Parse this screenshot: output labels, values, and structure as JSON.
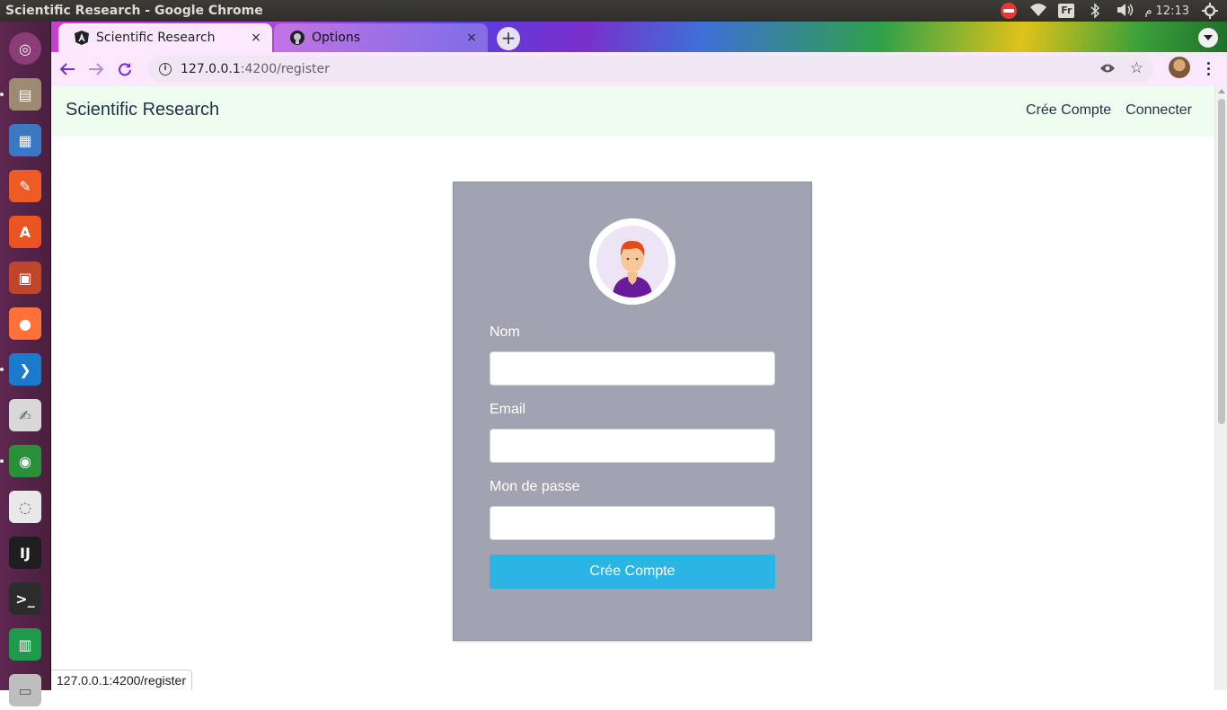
{
  "os": {
    "window_title": "Scientific Research - Google Chrome",
    "keyboard_layout": "Fr",
    "clock_ampm": "م",
    "clock_time": "12:13"
  },
  "launcher": {
    "apps": [
      {
        "name": "ubuntu-dash",
        "glyph": "◎",
        "color": "#8c3c77"
      },
      {
        "name": "files",
        "glyph": "▤",
        "color": "#9c8a72"
      },
      {
        "name": "libreoffice-impress-doc",
        "glyph": "▦",
        "color": "#3a78c3"
      },
      {
        "name": "postman",
        "glyph": "✎",
        "color": "#ef5b25"
      },
      {
        "name": "ubuntu-software",
        "glyph": "A",
        "color": "#e95420"
      },
      {
        "name": "libreoffice-impress",
        "glyph": "▣",
        "color": "#c0462a"
      },
      {
        "name": "firefox",
        "glyph": "●",
        "color": "#ff7139"
      },
      {
        "name": "vscode",
        "glyph": "❯",
        "color": "#1c7acc"
      },
      {
        "name": "text-editor",
        "glyph": "✍",
        "color": "#d8d8d8"
      },
      {
        "name": "chrome",
        "glyph": "◉",
        "color": "#2a8f3a"
      },
      {
        "name": "evince",
        "glyph": "◌",
        "color": "#e8e8e8"
      },
      {
        "name": "intellij",
        "glyph": "IJ",
        "color": "#1e1e1e"
      },
      {
        "name": "terminal",
        "glyph": ">_",
        "color": "#2c2c2c"
      },
      {
        "name": "libreoffice-calc",
        "glyph": "▥",
        "color": "#1e9b4a"
      },
      {
        "name": "printer",
        "glyph": "▭",
        "color": "#bdbdbd"
      }
    ]
  },
  "browser": {
    "tabs": [
      {
        "label": "Scientific Research",
        "close": "×"
      },
      {
        "label": "Options",
        "close": "×"
      }
    ],
    "new_tab": "+",
    "url_host": "127.0.0.1",
    "url_path": ":4200/register",
    "status_url": "127.0.0.1:4200/register"
  },
  "page": {
    "brand": "Scientific Research",
    "nav": {
      "register": "Crée Compte",
      "login": "Connecter"
    },
    "form": {
      "name_label": "Nom",
      "email_label": "Email",
      "password_label": "Mon de passe",
      "submit_label": "Crée Compte",
      "name_value": "",
      "email_value": "",
      "password_value": ""
    }
  },
  "colors": {
    "card_background": "#a2a3b0",
    "submit_button": "#2bb5e5",
    "navbar_background": "#effcf0",
    "tab_active": "#fce8fd"
  }
}
